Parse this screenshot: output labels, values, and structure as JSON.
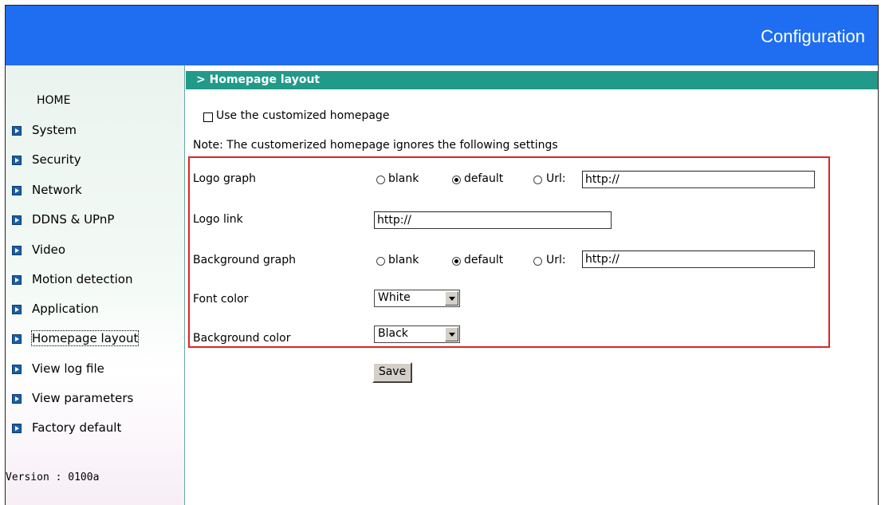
{
  "header": {
    "title": "Configuration"
  },
  "sidebar": {
    "home": "HOME",
    "items": [
      {
        "label": "System"
      },
      {
        "label": "Security"
      },
      {
        "label": "Network"
      },
      {
        "label": "DDNS & UPnP"
      },
      {
        "label": "Video"
      },
      {
        "label": "Motion detection"
      },
      {
        "label": "Application"
      },
      {
        "label": "Homepage layout",
        "selected": true
      },
      {
        "label": "View log file"
      },
      {
        "label": "View parameters"
      },
      {
        "label": "Factory default"
      }
    ],
    "version": "Version : 0100a"
  },
  "main": {
    "section_title": "> Homepage layout",
    "use_custom": {
      "label": "Use the customized homepage",
      "checked": false
    },
    "note": "Note: The customerized homepage ignores the following settings",
    "logo_graph": {
      "label": "Logo graph",
      "options": [
        "blank",
        "default",
        "Url:"
      ],
      "selected": "default",
      "url_value": "http://"
    },
    "logo_link": {
      "label": "Logo link",
      "value": "http://"
    },
    "background_graph": {
      "label": "Background graph",
      "options": [
        "blank",
        "default",
        "Url:"
      ],
      "selected": "default",
      "url_value": "http://"
    },
    "font_color": {
      "label": "Font color",
      "value": "White"
    },
    "background_color": {
      "label": "Background color",
      "value": "Black"
    },
    "save_label": "Save"
  },
  "colors": {
    "banner": "#1f6ef1",
    "section_header": "#229a8a",
    "highlight_border": "#e32222"
  }
}
